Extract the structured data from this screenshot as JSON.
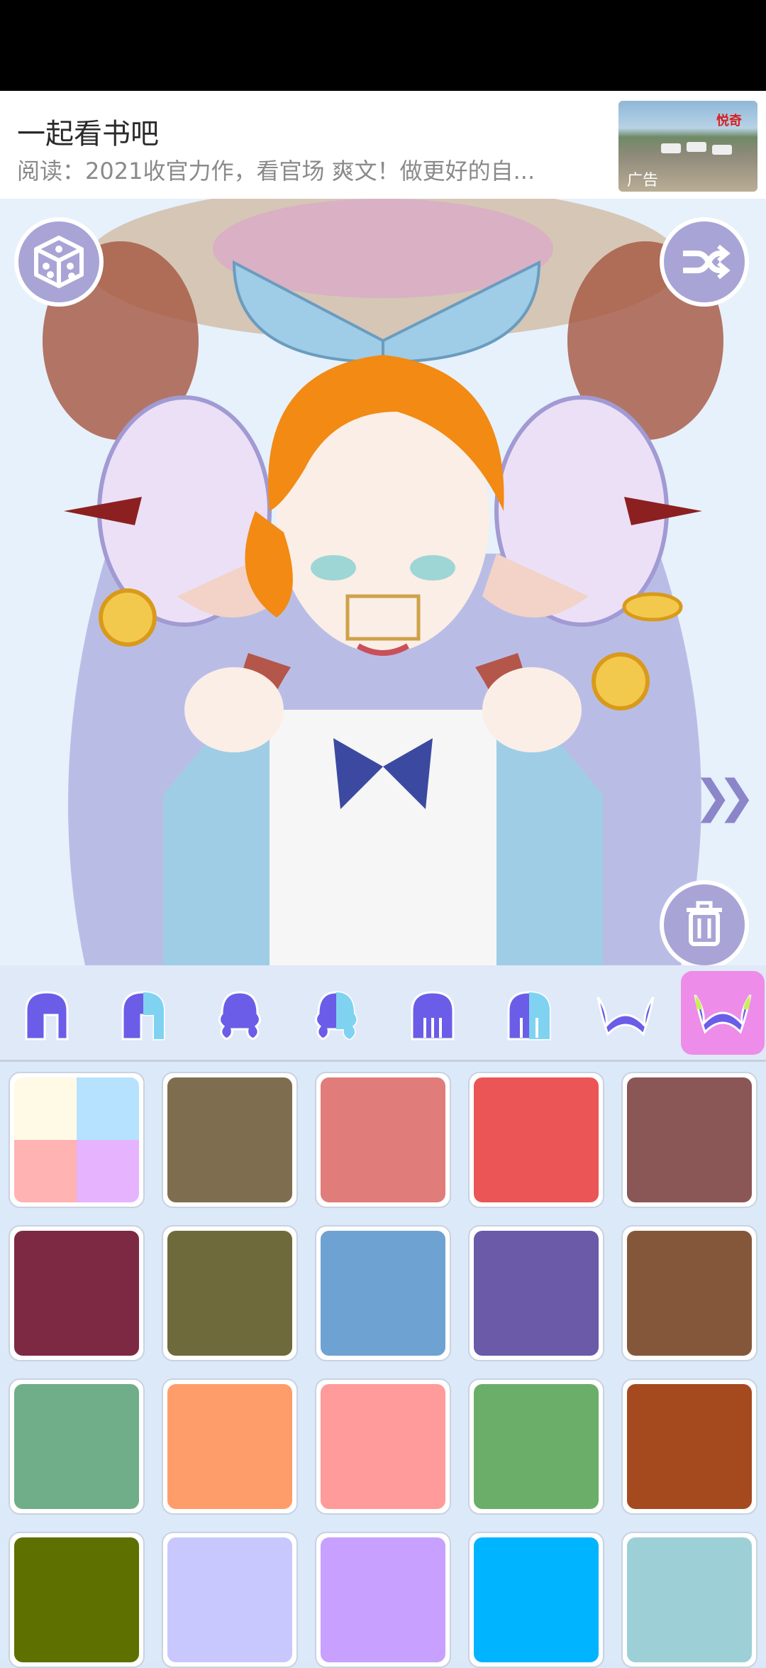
{
  "ad": {
    "title": "一起看书吧",
    "description": "阅读：2021收官力作，看官场 爽文！做更好的自...",
    "badge": "广告"
  },
  "canvas": {
    "random_icon": "dice-icon",
    "shuffle_icon": "shuffle-icon",
    "next_icon": "double-chevron-right-icon",
    "delete_icon": "trash-icon"
  },
  "tabs": [
    {
      "icon": "hair-front-icon",
      "active": false
    },
    {
      "icon": "hair-front-color-icon",
      "active": false
    },
    {
      "icon": "hair-back-icon",
      "active": false
    },
    {
      "icon": "hair-back-color-icon",
      "active": false
    },
    {
      "icon": "hair-long-icon",
      "active": false
    },
    {
      "icon": "hair-long-color-icon",
      "active": false
    },
    {
      "icon": "horns-icon",
      "active": false
    },
    {
      "icon": "horns-color-icon",
      "active": true
    }
  ],
  "palette": {
    "accent": "#6b5de8",
    "active_tab": "#ee8ce9",
    "colors": [
      "multi",
      "#7f6d50",
      "#e07c7a",
      "#eb5555",
      "#8a5656",
      "#7d2944",
      "#6e6a3c",
      "#6ea2d3",
      "#6a5aa8",
      "#85573a",
      "#6fae88",
      "#ff9d6a",
      "#ff9b9b",
      "#6aae6a",
      "#a54a1f",
      "#5e7000",
      "#c8c8ff",
      "#c8a0ff",
      "#00b4ff",
      "#9dcfd6"
    ],
    "multi_colors": [
      "#fffae6",
      "#b6e2ff",
      "#ffb3b3",
      "#e6b3ff"
    ]
  }
}
